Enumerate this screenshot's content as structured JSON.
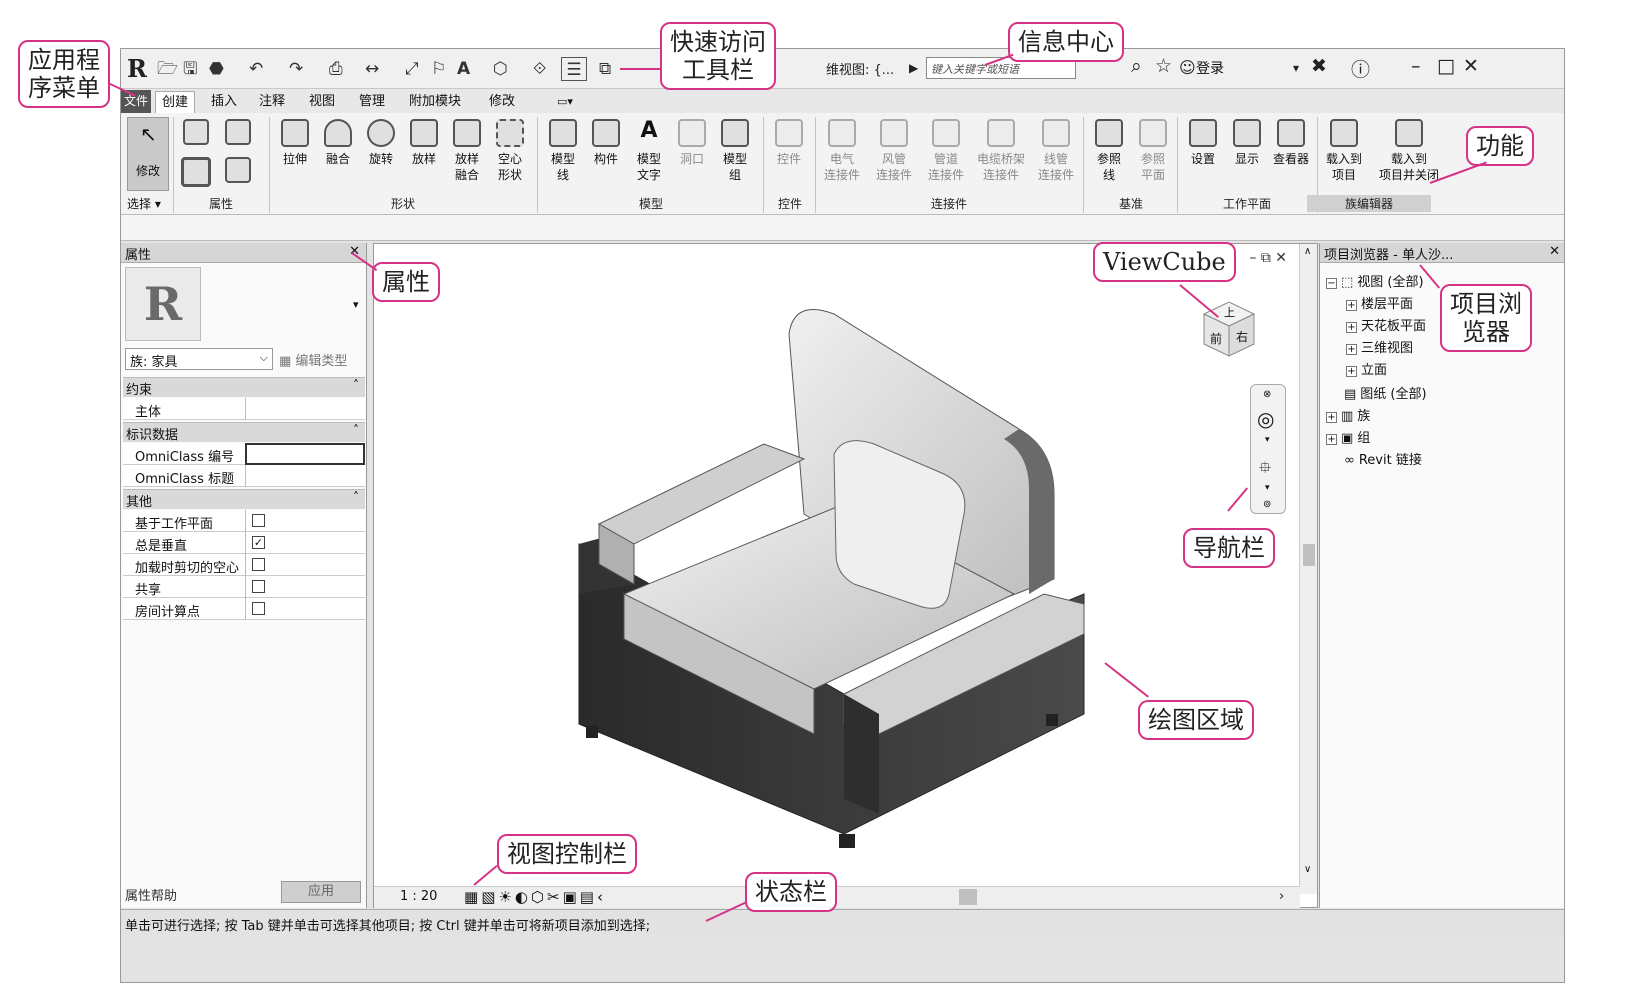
{
  "qat": {
    "app_logo": "R",
    "icons": [
      "open-icon",
      "save-icon",
      "sync-icon",
      "undo-icon",
      "redo-icon",
      "print-icon",
      "measure-icon",
      "dimension-icon",
      "tag-icon",
      "text-icon",
      "3d-view-icon",
      "section-icon",
      "thin-lines-icon",
      "switch-window-icon"
    ],
    "text_tool": "A"
  },
  "infocenter": {
    "view_title": "维视图: {...",
    "search_placeholder": "键入关键字或短语",
    "login_label": "登录",
    "login_chevron": "▾"
  },
  "tabs": {
    "file": "文件",
    "items": [
      "创建",
      "插入",
      "注释",
      "视图",
      "管理",
      "附加模块",
      "修改"
    ],
    "active": "创建"
  },
  "ribbon": {
    "modify": "修改",
    "select": "选择 ▾",
    "groups": {
      "select": "选择",
      "properties": "属性",
      "forms": "形状",
      "model": "模型",
      "control": "控件",
      "connectors": "连接件",
      "datum": "基准",
      "work_plane": "工作平面",
      "family_editor": "族编辑器"
    },
    "forms_buttons": [
      "拉伸",
      "融合",
      "旋转",
      "放样",
      "放样\n融合",
      "空心\n形状"
    ],
    "model_buttons": [
      "模型\n线",
      "构件",
      "模型\n文字",
      "洞口",
      "模型\n组"
    ],
    "control_buttons": [
      "控件"
    ],
    "connector_buttons": [
      "电气\n连接件",
      "风管\n连接件",
      "管道\n连接件",
      "电缆桥架\n连接件",
      "线管\n连接件"
    ],
    "datum_buttons": [
      "参照\n线",
      "参照\n平面"
    ],
    "workplane_buttons": [
      "设置",
      "显示",
      "查看器"
    ],
    "family_buttons": [
      "载入到\n项目",
      "载入到\n项目并关闭"
    ]
  },
  "properties": {
    "title": "属性",
    "preview_letter": "R",
    "family_select": "族: 家具",
    "edit_type": "编辑类型",
    "sections": [
      {
        "name": "约束",
        "rows": [
          {
            "label": "主体",
            "type": "text",
            "value": ""
          }
        ]
      },
      {
        "name": "标识数据",
        "rows": [
          {
            "label": "OmniClass 编号",
            "type": "text",
            "value": ""
          },
          {
            "label": "OmniClass 标题",
            "type": "text",
            "value": ""
          }
        ]
      },
      {
        "name": "其他",
        "rows": [
          {
            "label": "基于工作平面",
            "type": "check",
            "checked": false
          },
          {
            "label": "总是垂直",
            "type": "check",
            "checked": true
          },
          {
            "label": "加载时剪切的空心",
            "type": "check",
            "checked": false
          },
          {
            "label": "共享",
            "type": "check",
            "checked": false
          },
          {
            "label": "房间计算点",
            "type": "check",
            "checked": false
          }
        ]
      }
    ],
    "help": "属性帮助",
    "apply": "应用"
  },
  "drawing": {
    "scale": "1 : 20",
    "viewcube_faces": {
      "top": "上",
      "front": "前",
      "right": "右"
    }
  },
  "browser": {
    "title": "项目浏览器 - 单人沙...",
    "items": [
      {
        "label": "视图 (全部)",
        "level": 0,
        "exp": "−"
      },
      {
        "label": "楼层平面",
        "level": 1,
        "exp": "+"
      },
      {
        "label": "天花板平面",
        "level": 1,
        "exp": "+"
      },
      {
        "label": "三维视图",
        "level": 1,
        "exp": "+"
      },
      {
        "label": "立面",
        "level": 1,
        "exp": "+"
      },
      {
        "label": "图纸 (全部)",
        "level": 0,
        "exp": ""
      },
      {
        "label": "族",
        "level": 0,
        "exp": "+"
      },
      {
        "label": "组",
        "level": 0,
        "exp": "+"
      },
      {
        "label": "Revit 链接",
        "level": 0,
        "exp": ""
      }
    ]
  },
  "status": {
    "text": "单击可进行选择; 按 Tab 键并单击可选择其他项目; 按 Ctrl 键并单击可将新项目添加到选择;"
  },
  "callouts": {
    "app_menu": "应用程\n序菜单",
    "qat": "快速访问\n工具栏",
    "infocenter": "信息中心",
    "ribbon": "功能",
    "properties": "属性",
    "viewcube": "ViewCube",
    "project_browser": "项目浏\n览器",
    "nav_bar": "导航栏",
    "drawing_area": "绘图区域",
    "view_control_bar": "视图控制栏",
    "status_bar": "状态栏"
  },
  "colors": {
    "callout_border": "#d63384",
    "ribbon_bg": "#f3f3f3",
    "sofa_frame": "#3a3a3a",
    "sofa_cushion": "#d8d8d8"
  }
}
